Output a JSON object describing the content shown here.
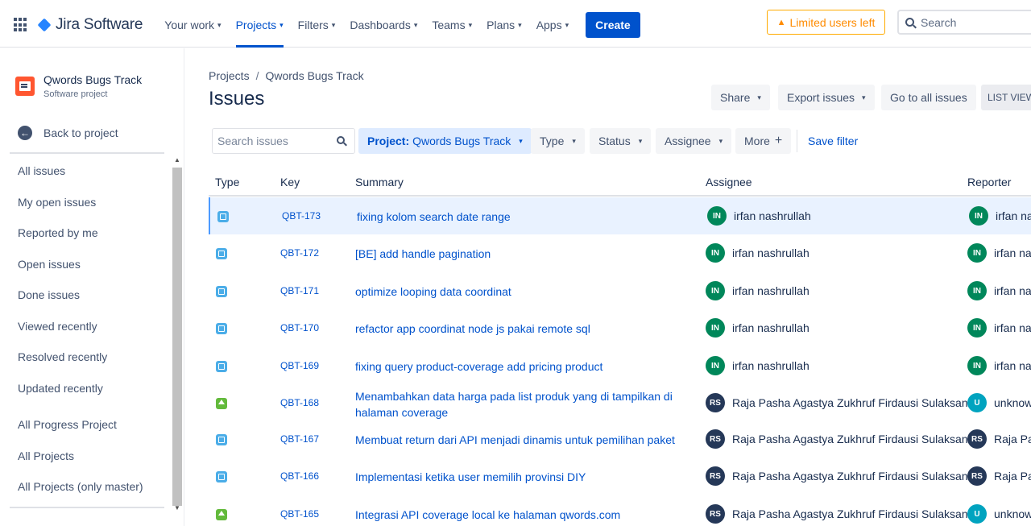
{
  "topnav": {
    "app_name": "Jira Software",
    "items": [
      {
        "label": "Your work"
      },
      {
        "label": "Projects"
      },
      {
        "label": "Filters"
      },
      {
        "label": "Dashboards"
      },
      {
        "label": "Teams"
      },
      {
        "label": "Plans"
      },
      {
        "label": "Apps"
      }
    ],
    "create_label": "Create",
    "limited_label": "Limited users left",
    "search_placeholder": "Search"
  },
  "sidebar": {
    "project_name": "Qwords Bugs Track",
    "project_type": "Software project",
    "back_label": "Back to project",
    "filters": [
      {
        "label": "All issues"
      },
      {
        "label": "My open issues"
      },
      {
        "label": "Reported by me"
      },
      {
        "label": "Open issues"
      },
      {
        "label": "Done issues"
      },
      {
        "label": "Viewed recently"
      },
      {
        "label": "Resolved recently"
      },
      {
        "label": "Updated recently"
      },
      {
        "label": "All Progress Project"
      },
      {
        "label": "All Projects"
      },
      {
        "label": "All Projects (only master)"
      }
    ]
  },
  "main": {
    "breadcrumb": {
      "root": "Projects",
      "separator": "/",
      "current": "Qwords Bugs Track"
    },
    "title": "Issues",
    "buttons": {
      "share": "Share",
      "export": "Export issues",
      "goto_all": "Go to all issues",
      "list_view": "LIST VIEW"
    },
    "search_placeholder": "Search issues",
    "chips": {
      "project_prefix": "Project:",
      "project_value": "Qwords Bugs Track",
      "type": "Type",
      "status": "Status",
      "assignee": "Assignee",
      "more": "More"
    },
    "save_filter": "Save filter"
  },
  "table": {
    "headers": {
      "type": "Type",
      "key": "Key",
      "summary": "Summary",
      "assignee": "Assignee",
      "reporter": "Reporter"
    },
    "rows": [
      {
        "type": "task",
        "key": "QBT-173",
        "summary": "fixing kolom search date range",
        "assignee_initials": "IN",
        "assignee": "irfan nashrullah",
        "reporter_initials": "IN",
        "reporter": "irfan na"
      },
      {
        "type": "task",
        "key": "QBT-172",
        "summary": "[BE] add handle pagination",
        "assignee_initials": "IN",
        "assignee": "irfan nashrullah",
        "reporter_initials": "IN",
        "reporter": "irfan na"
      },
      {
        "type": "task",
        "key": "QBT-171",
        "summary": "optimize looping data coordinat",
        "assignee_initials": "IN",
        "assignee": "irfan nashrullah",
        "reporter_initials": "IN",
        "reporter": "irfan na"
      },
      {
        "type": "task",
        "key": "QBT-170",
        "summary": "refactor app coordinat node js pakai remote sql",
        "assignee_initials": "IN",
        "assignee": "irfan nashrullah",
        "reporter_initials": "IN",
        "reporter": "irfan na"
      },
      {
        "type": "task",
        "key": "QBT-169",
        "summary": "fixing query product-coverage add pricing product",
        "assignee_initials": "IN",
        "assignee": "irfan nashrullah",
        "reporter_initials": "IN",
        "reporter": "irfan na"
      },
      {
        "type": "story",
        "key": "QBT-168",
        "summary": "Menambahkan data harga pada list produk yang di tampilkan di halaman coverage",
        "assignee_initials": "RS",
        "assignee": "Raja Pasha Agastya Zukhruf Firdausi Sulaksana",
        "reporter_initials": "U",
        "reporter": "unknow"
      },
      {
        "type": "task",
        "key": "QBT-167",
        "summary": "Membuat return dari API menjadi dinamis untuk pemilihan paket",
        "assignee_initials": "RS",
        "assignee": "Raja Pasha Agastya Zukhruf Firdausi Sulaksana",
        "reporter_initials": "RS",
        "reporter": "Raja Pas"
      },
      {
        "type": "task",
        "key": "QBT-166",
        "summary": "Implementasi ketika user memilih provinsi DIY",
        "assignee_initials": "RS",
        "assignee": "Raja Pasha Agastya Zukhruf Firdausi Sulaksana",
        "reporter_initials": "RS",
        "reporter": "Raja Pas"
      },
      {
        "type": "story",
        "key": "QBT-165",
        "summary": "Integrasi API coverage local ke halaman qwords.com",
        "assignee_initials": "RS",
        "assignee": "Raja Pasha Agastya Zukhruf Firdausi Sulaksana",
        "reporter_initials": "U",
        "reporter": "unknow"
      }
    ]
  },
  "colors": {
    "accent": "#0052cc",
    "avatar_green": "#00875a",
    "avatar_dark": "#253858",
    "avatar_teal": "#00a3bf",
    "task_icon": "#4bade8",
    "story_icon": "#63ba3c"
  }
}
